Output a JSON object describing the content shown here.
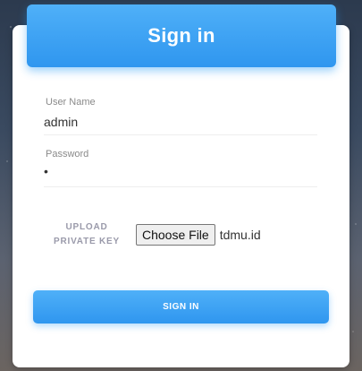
{
  "header": {
    "title": "Sign in"
  },
  "form": {
    "username": {
      "label": "User Name",
      "value": "admin"
    },
    "password": {
      "label": "Password",
      "value": "•"
    },
    "upload": {
      "label_line1": "UPLOAD",
      "label_line2": "PRIVATE KEY",
      "button_label": "Choose File",
      "file_name": "tdmu.id"
    },
    "submit_label": "SIGN IN"
  },
  "colors": {
    "accent": "#2f96ef",
    "card": "#ffffff"
  }
}
